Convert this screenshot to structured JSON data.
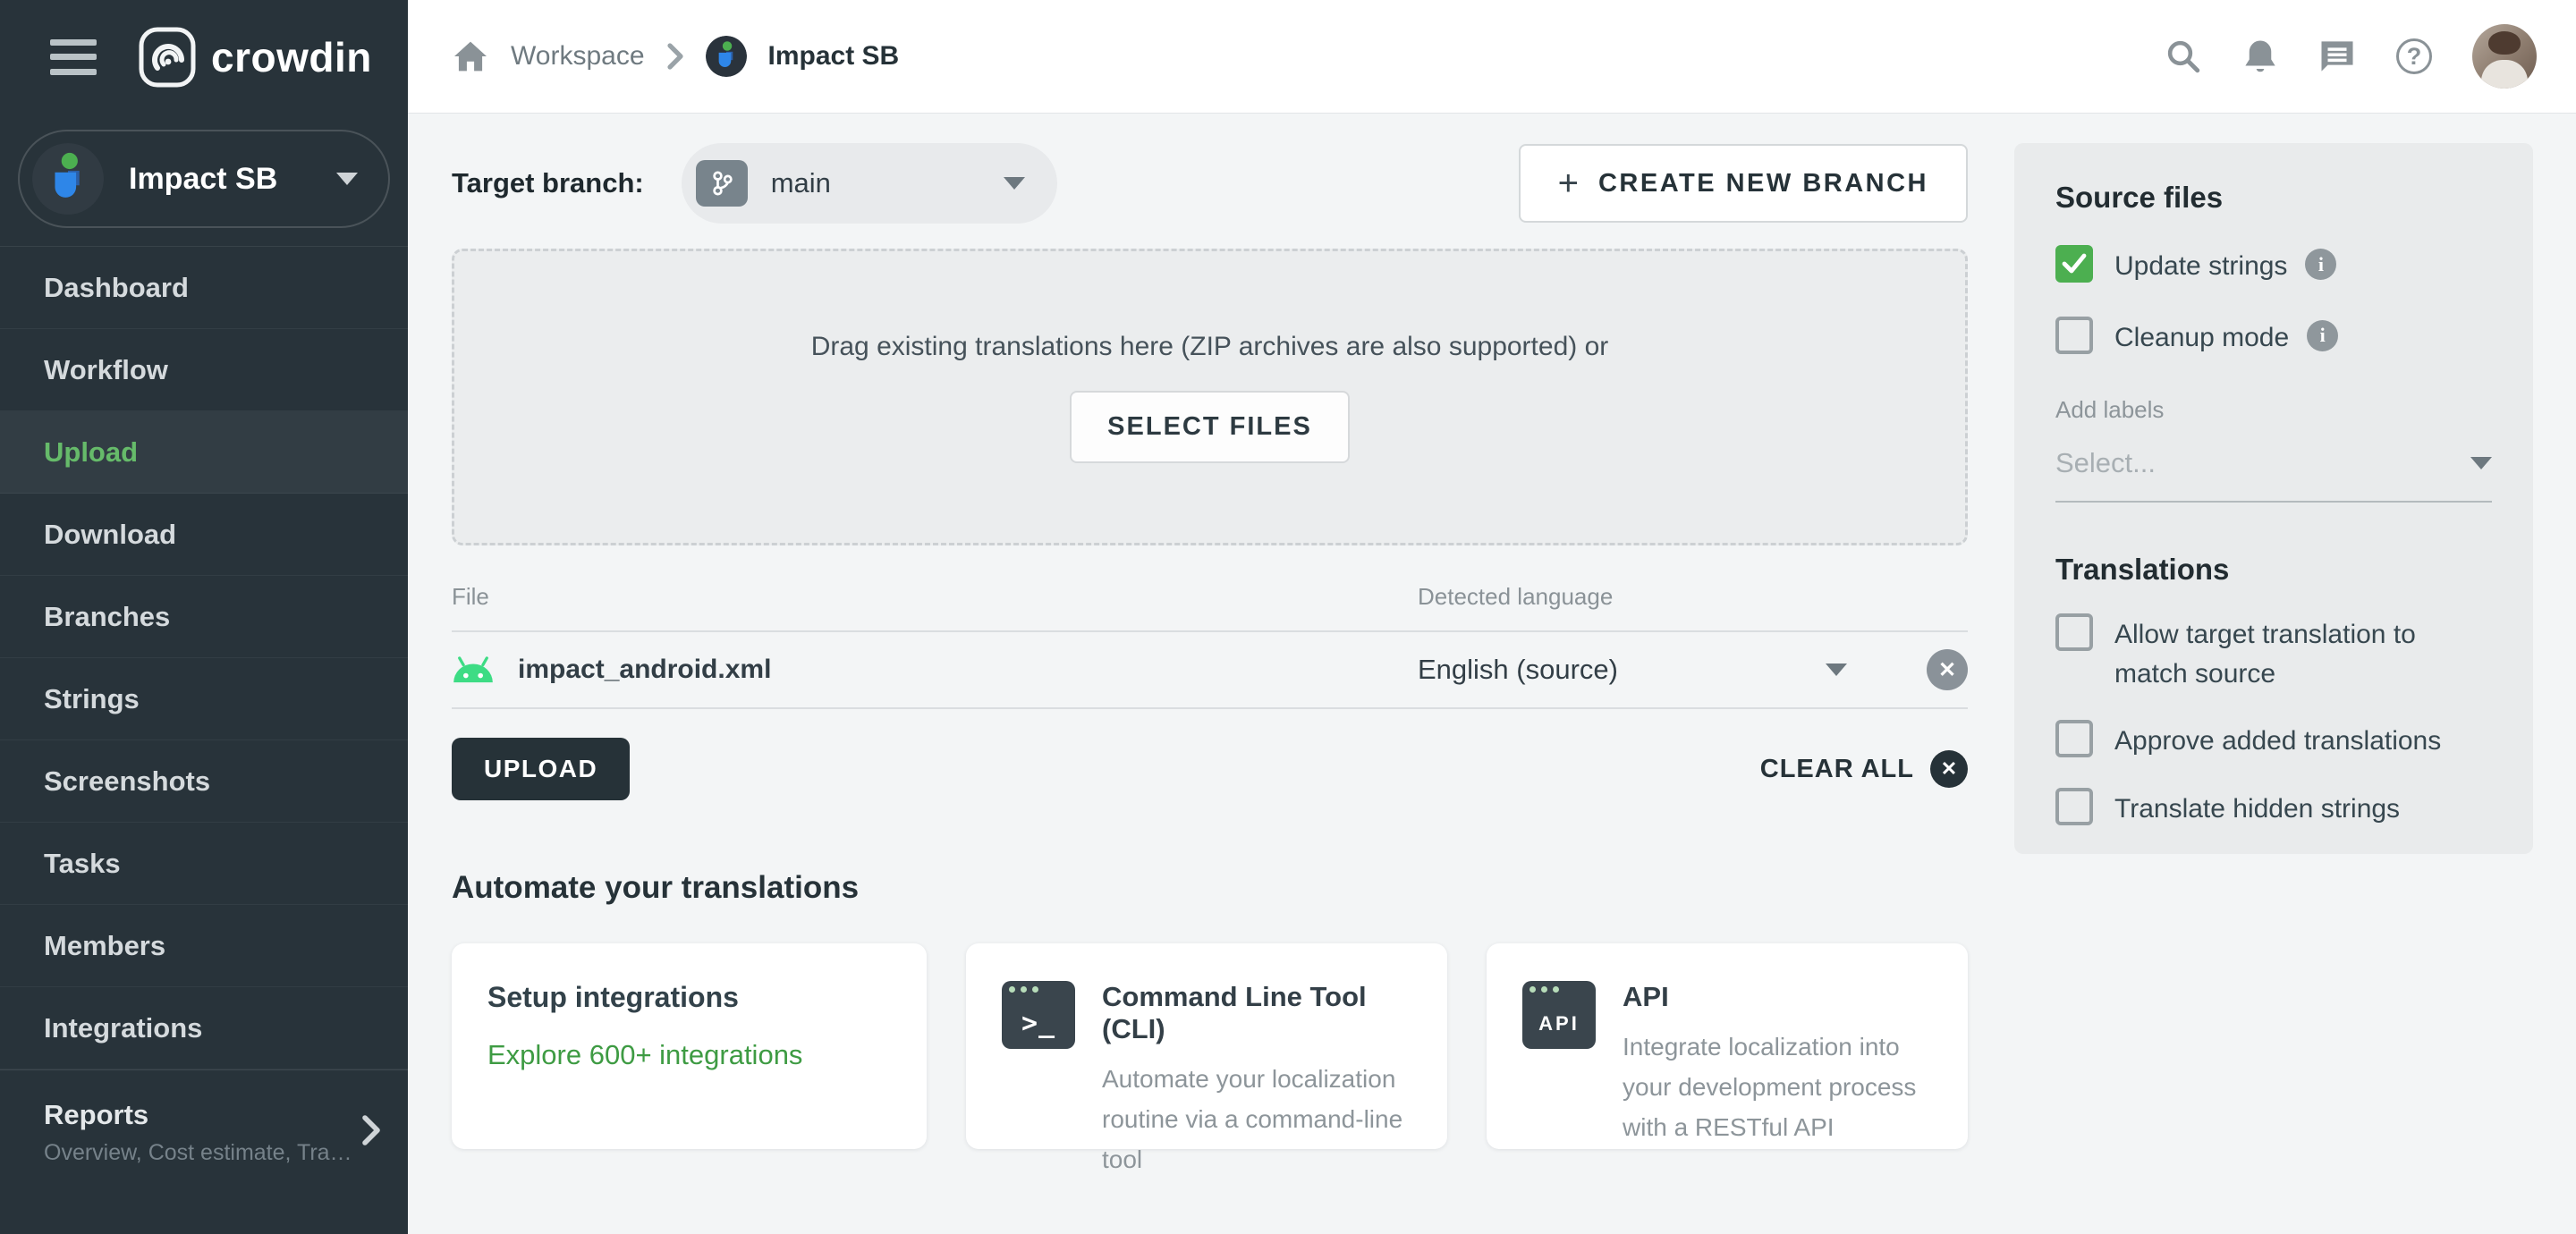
{
  "colors": {
    "sidebar_bg": "#28333a",
    "accent_green": "#43a047",
    "sidebar_active_green": "#66bb6a",
    "checkbox_green": "#4caf50",
    "android_green": "#3ddc84",
    "dark": "#263238",
    "page_bg": "#f3f5f6",
    "panel_bg": "#e9ebec"
  },
  "header": {
    "brand": "crowdin",
    "breadcrumb": {
      "workspace": "Workspace",
      "project": "Impact SB"
    },
    "icons": [
      "search-icon",
      "notifications-bell-icon",
      "messages-icon",
      "help-icon",
      "user-avatar"
    ]
  },
  "sidebar": {
    "project_name": "Impact SB",
    "items": [
      {
        "label": "Dashboard",
        "active": false
      },
      {
        "label": "Workflow",
        "active": false
      },
      {
        "label": "Upload",
        "active": true
      },
      {
        "label": "Download",
        "active": false
      },
      {
        "label": "Branches",
        "active": false
      },
      {
        "label": "Strings",
        "active": false
      },
      {
        "label": "Screenshots",
        "active": false
      },
      {
        "label": "Tasks",
        "active": false
      },
      {
        "label": "Members",
        "active": false
      },
      {
        "label": "Integrations",
        "active": false
      }
    ],
    "reports": {
      "label": "Reports",
      "subtitle": "Overview, Cost estimate, Transl…"
    }
  },
  "main": {
    "target_branch_label": "Target branch:",
    "branch_selector": {
      "value": "main"
    },
    "create_branch_button": {
      "plus": "+",
      "label": "CREATE NEW BRANCH"
    },
    "dropzone": {
      "text": "Drag existing translations here (ZIP archives are also supported) or",
      "button": "SELECT FILES"
    },
    "files_table": {
      "file_header": "File",
      "language_header": "Detected language",
      "rows": [
        {
          "file_name": "impact_android.xml",
          "detected_language": "English (source)"
        }
      ]
    },
    "upload_button": "UPLOAD",
    "clear_all": "CLEAR ALL",
    "automate": {
      "title": "Automate your translations",
      "cards": [
        {
          "title": "Setup integrations",
          "link": "Explore 600+ integrations"
        },
        {
          "title": "Command Line Tool (CLI)",
          "icon_text": ">_",
          "description": "Automate your localization routine via a command-line tool"
        },
        {
          "title": "API",
          "icon_text": "API",
          "description": "Integrate localization into your development process with a RESTful API"
        }
      ]
    }
  },
  "panel": {
    "source_files_title": "Source files",
    "update_strings": {
      "label": "Update strings",
      "checked": true
    },
    "cleanup_mode": {
      "label": "Cleanup mode",
      "checked": false
    },
    "add_labels_label": "Add labels",
    "labels_select_placeholder": "Select...",
    "translations_title": "Translations",
    "options": [
      {
        "label": "Allow target translation to match source",
        "checked": false
      },
      {
        "label": "Approve added translations",
        "checked": false
      },
      {
        "label": "Translate hidden strings",
        "checked": false
      }
    ]
  }
}
